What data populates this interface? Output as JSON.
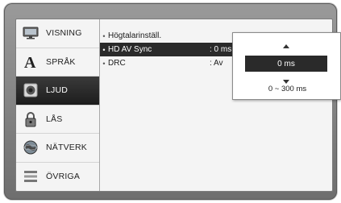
{
  "sidebar": {
    "items": [
      {
        "label": "VISNING",
        "icon": "display-icon",
        "active": false
      },
      {
        "label": "SPRÅK",
        "icon": "language-icon",
        "active": false
      },
      {
        "label": "LJUD",
        "icon": "speaker-icon",
        "active": true
      },
      {
        "label": "LÅS",
        "icon": "lock-icon",
        "active": false
      },
      {
        "label": "NÄTVERK",
        "icon": "network-globe-icon",
        "active": false
      },
      {
        "label": "ÖVRIGA",
        "icon": "other-settings-icon",
        "active": false
      }
    ]
  },
  "settings": {
    "rows": [
      {
        "bullet": "•",
        "label": "Högtalarinställ.",
        "value": "",
        "selected": false
      },
      {
        "bullet": "•",
        "label": "HD AV Sync",
        "value": ": 0 ms",
        "selected": true
      },
      {
        "bullet": "•",
        "label": "DRC",
        "value": ": Av",
        "selected": false
      }
    ]
  },
  "popup": {
    "current_value": "0 ms",
    "range": "0 ~ 300 ms"
  },
  "colors": {
    "active_background": "#1d1d1d",
    "panel_background": "#f4f4f4",
    "frame": "#6e6e6e"
  }
}
